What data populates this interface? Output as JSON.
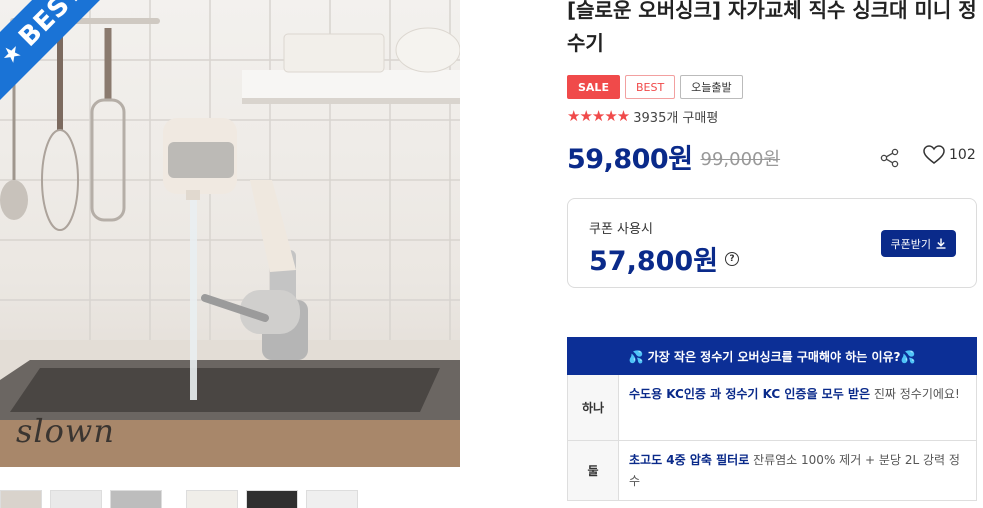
{
  "image": {
    "ribbon_label": "BEST",
    "brand_watermark": "slown"
  },
  "product": {
    "title": "[슬로운 오버싱크] 자가교체 직수 싱크대 미니 정수기",
    "badges": [
      "SALE",
      "BEST",
      "오늘출발"
    ],
    "rating_stars": 5,
    "review_count": "3935개 구매평",
    "price": "59,800원",
    "original_price": "99,000원",
    "like_count": "102"
  },
  "coupon": {
    "label": "쿠폰 사용시",
    "price": "57,800원",
    "button_label": "쿠폰받기"
  },
  "reasons": {
    "header": "💦 가장 작은 정수기 오버싱크를 구매해야 하는 이유?💦",
    "rows": [
      {
        "num": "하나",
        "highlight": "수도용 KC인증 과 정수기 KC 인증을 모두 받은",
        "rest": " 진짜 정수기에요!"
      },
      {
        "num": "둘",
        "highlight": "초고도 4중 압축 필터로",
        "rest": " 잔류염소 100% 제거 + 분당 2L 강력 정수"
      }
    ]
  },
  "colors": {
    "accent_navy": "#0a2a8a",
    "sale_red": "#f04a4a",
    "ribbon_blue": "#1a73d6"
  }
}
